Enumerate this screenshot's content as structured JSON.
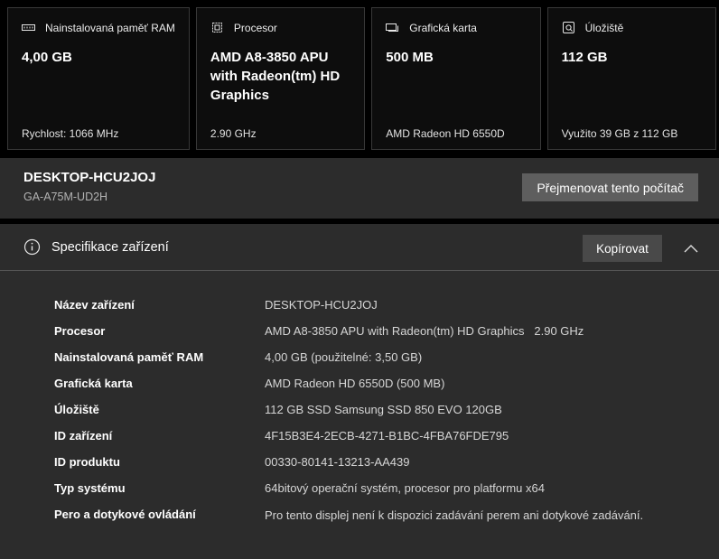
{
  "cards": [
    {
      "icon": "memory-icon",
      "label": "Nainstalovaná paměť RAM",
      "value": "4,00 GB",
      "footer": "Rychlost: 1066 MHz"
    },
    {
      "icon": "cpu-icon",
      "label": "Procesor",
      "value": "AMD A8-3850 APU with Radeon(tm) HD Graphics",
      "footer": "2.90 GHz"
    },
    {
      "icon": "gpu-icon",
      "label": "Grafická karta",
      "value": "500 MB",
      "footer": "AMD Radeon HD 6550D"
    },
    {
      "icon": "storage-icon",
      "label": "Úložiště",
      "value": "112 GB",
      "footer": "Využito 39 GB z 112 GB"
    }
  ],
  "device": {
    "name": "DESKTOP-HCU2JOJ",
    "model": "GA-A75M-UD2H",
    "rename_button": "Přejmenovat tento počítač"
  },
  "specs": {
    "title": "Specifikace zařízení",
    "copy_button": "Kopírovat",
    "collapse_icon": "chevron-up",
    "rows": [
      {
        "label": "Název zařízení",
        "value": "DESKTOP-HCU2JOJ"
      },
      {
        "label": "Procesor",
        "value": "AMD A8-3850 APU with Radeon(tm) HD Graphics   2.90 GHz"
      },
      {
        "label": "Nainstalovaná paměť RAM",
        "value": "4,00 GB (použitelné: 3,50 GB)"
      },
      {
        "label": "Grafická karta",
        "value": "AMD Radeon HD 6550D (500 MB)"
      },
      {
        "label": "Úložiště",
        "value": "112 GB SSD Samsung SSD 850 EVO 120GB"
      },
      {
        "label": "ID zařízení",
        "value": "4F15B3E4-2ECB-4271-B1BC-4FBA76FDE795"
      },
      {
        "label": "ID produktu",
        "value": "00330-80141-13213-AA439"
      },
      {
        "label": "Typ systému",
        "value": "64bitový operační systém, procesor pro platformu x64"
      },
      {
        "label": "Pero a dotykové ovládání",
        "value": "Pro tento displej není k dispozici zadávání perem ani dotykové zadávání."
      }
    ]
  },
  "colors": {
    "page_background": "#000000",
    "card_background": "#0d0d0d",
    "card_border": "#383838",
    "panel_background": "#2c2c2c",
    "button_gray": "#5e5e5e",
    "copy_button_gray": "#494949",
    "divider": "#555555",
    "value_text": "#d6d6d6"
  }
}
